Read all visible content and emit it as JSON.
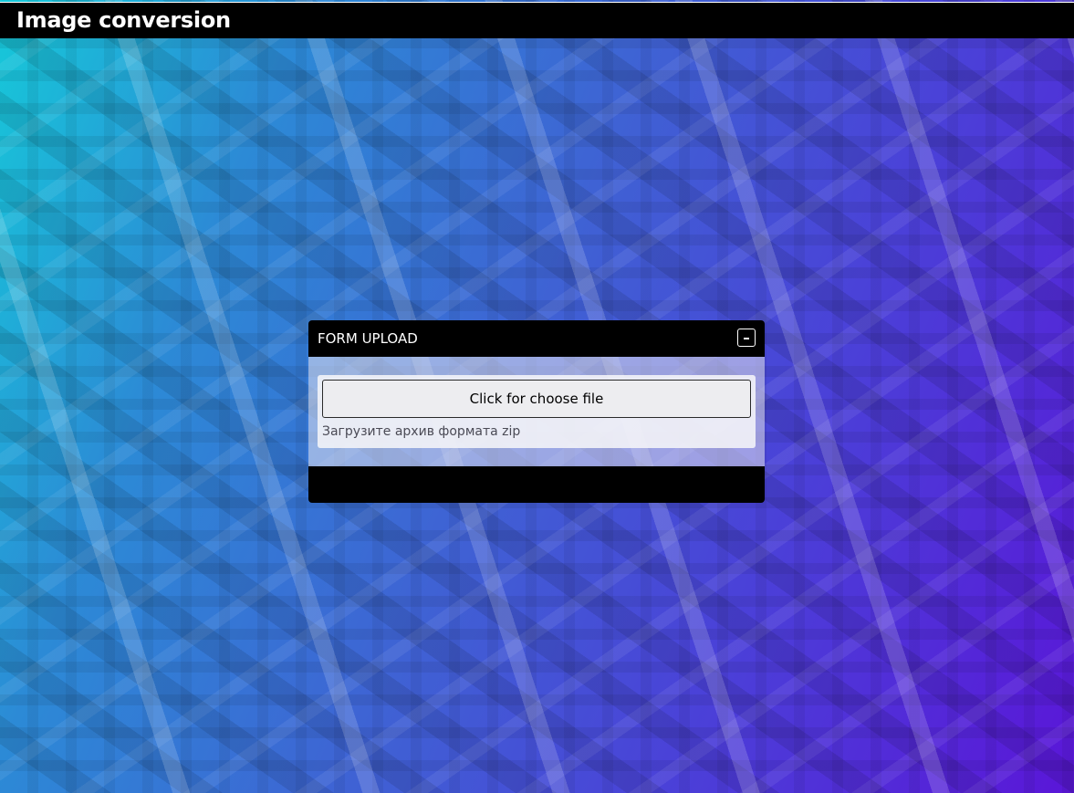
{
  "app": {
    "title": "Image conversion"
  },
  "upload_panel": {
    "title": "FORM UPLOAD",
    "collapse_label": "-",
    "choose_file_label": "Click for choose file",
    "hint": "Загрузите архив формата zip"
  },
  "colors": {
    "header_bg": "#000000",
    "background_start": "#16c9d9",
    "background_end": "#5a16d8"
  },
  "icons": {
    "collapse": "minus-icon"
  }
}
